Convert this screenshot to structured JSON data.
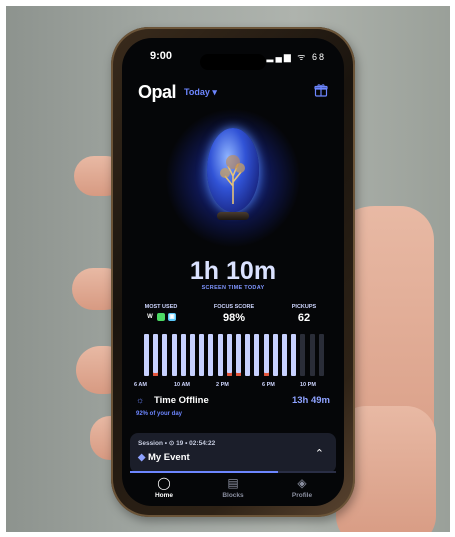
{
  "status_bar": {
    "time": "9:00",
    "icons": "▂▄▆ ᯤ 68"
  },
  "header": {
    "logo": "Opal",
    "range": "Today ▾",
    "gift_icon": "gift-icon"
  },
  "hero": {
    "value": "1h 10m",
    "label": "SCREEN TIME TODAY"
  },
  "stats": {
    "most_used": {
      "label": "MOST USED",
      "icons": [
        "W",
        "●",
        "▣"
      ]
    },
    "focus": {
      "label": "FOCUS SCORE",
      "value": "98%"
    },
    "pickups": {
      "label": "PICKUPS",
      "value": "62"
    }
  },
  "chart_data": {
    "type": "bar",
    "x_ticks": [
      "6 AM",
      "10 AM",
      "2 PM",
      "6 PM",
      "10 PM"
    ],
    "hourly_bars": 20,
    "active_bars": 17,
    "colors": {
      "active": "#c7d1ff",
      "inactive": "#2a2d38",
      "accent": "#e4553b"
    }
  },
  "offline": {
    "title": "Time Offline",
    "value": "13h 49m",
    "subtitle": "92% of your day"
  },
  "session": {
    "meta": "Session • ⊙ 19 • 02:54:22",
    "name": "My Event",
    "progress": 0.72
  },
  "tabs": [
    {
      "label": "Home",
      "icon": "ring-icon"
    },
    {
      "label": "Blocks",
      "icon": "layers-icon"
    },
    {
      "label": "Profile",
      "icon": "gem-icon"
    }
  ],
  "colors": {
    "accent": "#6d86ff",
    "background": "#050608"
  }
}
